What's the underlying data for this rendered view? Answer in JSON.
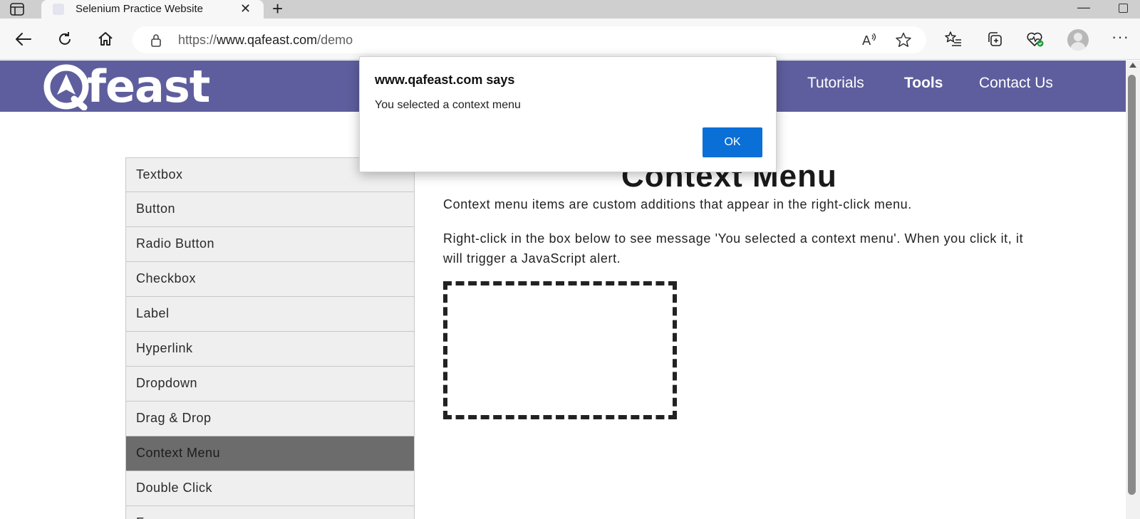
{
  "browser": {
    "tab_title": "Selenium Practice Website",
    "url_scheme": "https://",
    "url_host": "www.qafeast.com",
    "url_path": "/demo"
  },
  "site": {
    "logo_text": "feast",
    "nav": [
      "Tutorials",
      "Tools",
      "Contact Us"
    ]
  },
  "sidebar": {
    "items": [
      {
        "label": "Textbox"
      },
      {
        "label": "Button"
      },
      {
        "label": "Radio Button"
      },
      {
        "label": "Checkbox"
      },
      {
        "label": "Label"
      },
      {
        "label": "Hyperlink"
      },
      {
        "label": "Dropdown"
      },
      {
        "label": "Drag & Drop"
      },
      {
        "label": "Context Menu",
        "active": true
      },
      {
        "label": "Double Click"
      },
      {
        "label": "F"
      }
    ]
  },
  "main": {
    "title": "Context Menu",
    "paragraph1": "Context menu items are custom additions that appear in the right-click menu.",
    "paragraph2": "Right-click in the box below to see message 'You selected a context menu'. When you click it, it will trigger a JavaScript alert."
  },
  "alert": {
    "title": "www.qafeast.com says",
    "message": "You selected a context menu",
    "ok_label": "OK"
  },
  "colors": {
    "header_bg": "#5e5e9e",
    "active_menu_bg": "#6c6c6c",
    "ok_button": "#0a6fd6"
  }
}
